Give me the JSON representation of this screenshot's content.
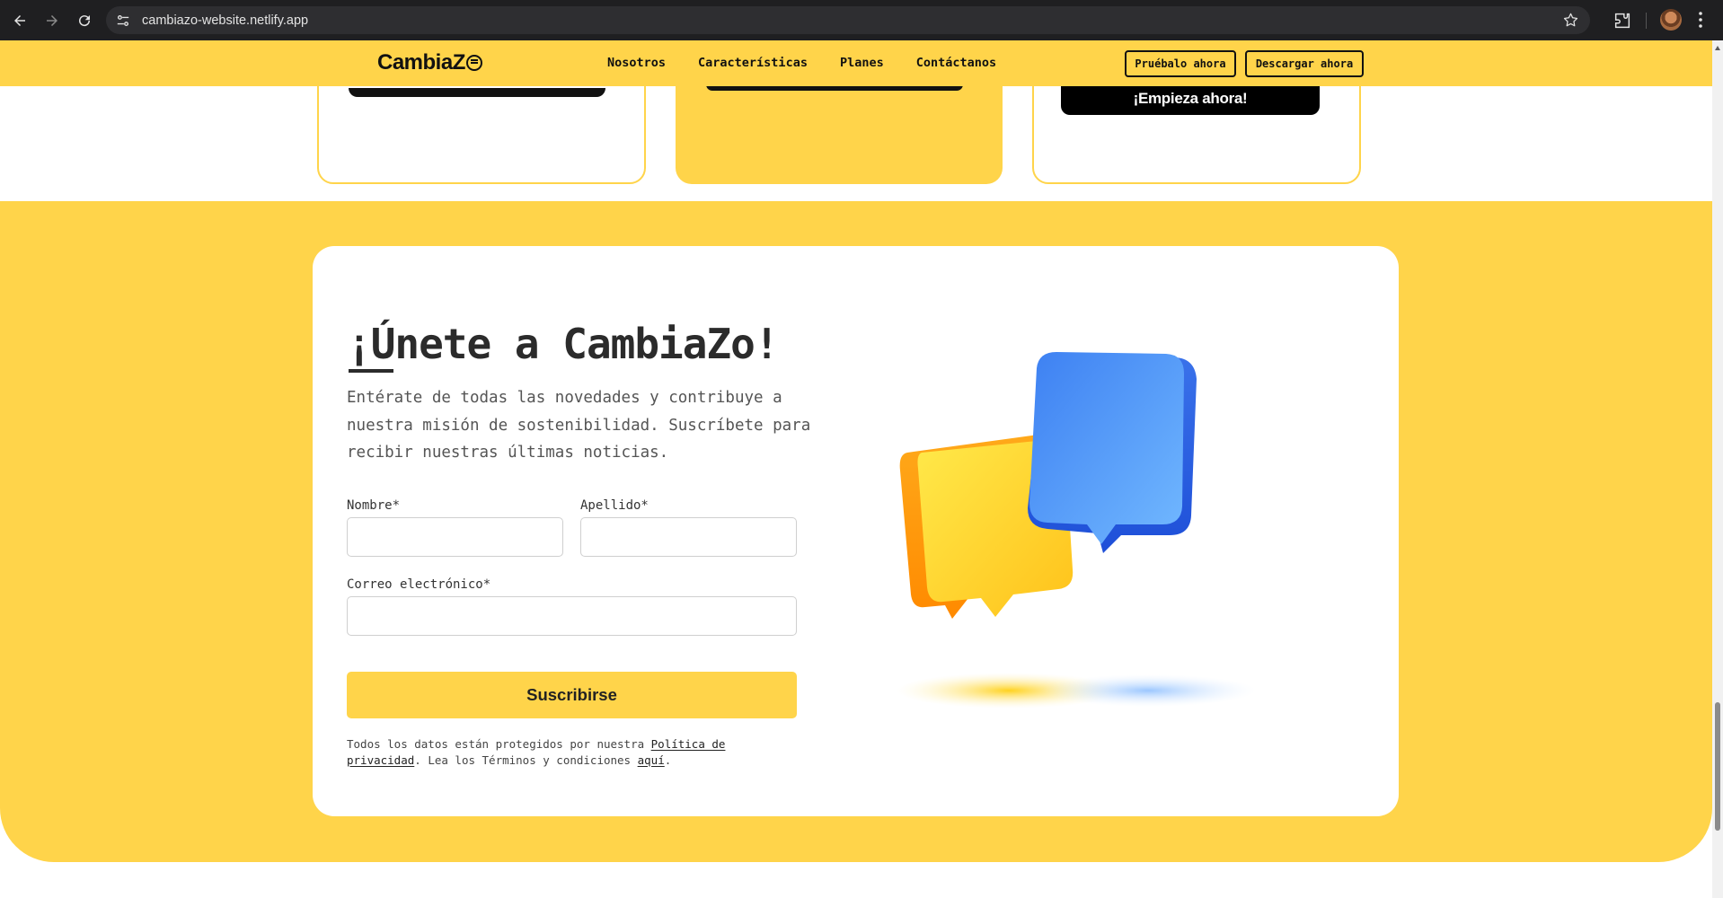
{
  "browser": {
    "url": "cambiazo-website.netlify.app"
  },
  "header": {
    "logo": "CambiaZ",
    "nav": [
      "Nosotros",
      "Características",
      "Planes",
      "Contáctanos"
    ],
    "try_button": "Pruébalo ahora",
    "download_button": "Descargar ahora"
  },
  "cards": {
    "cta_label": "¡Empieza ahora!"
  },
  "newsletter": {
    "title": "¡Únete a CambiaZo!",
    "intro": "Entérate de todas las novedades y contribuye a nuestra misión de sostenibilidad. Suscríbete para recibir nuestras últimas noticias.",
    "first_name_label": "Nombre*",
    "last_name_label": "Apellido*",
    "email_label": "Correo electrónico*",
    "first_name_value": "",
    "last_name_value": "",
    "email_value": "",
    "submit_label": "Suscribirse",
    "legal_prefix": "Todos los datos están protegidos por nuestra ",
    "privacy_link": "Política de privacidad",
    "legal_middle": ". Lea los Términos y condiciones ",
    "terms_link": "aquí",
    "legal_suffix": "."
  },
  "colors": {
    "brand_yellow": "#ffd44a",
    "text_dark": "#2b2b2b",
    "bubble_blue": "#3b82f6",
    "bubble_yellow": "#ffd21f"
  },
  "icons": [
    "back-arrow-icon",
    "forward-arrow-icon",
    "reload-icon",
    "site-settings-icon",
    "bookmark-star-icon",
    "extensions-icon",
    "profile-avatar",
    "chrome-menu-icon"
  ]
}
